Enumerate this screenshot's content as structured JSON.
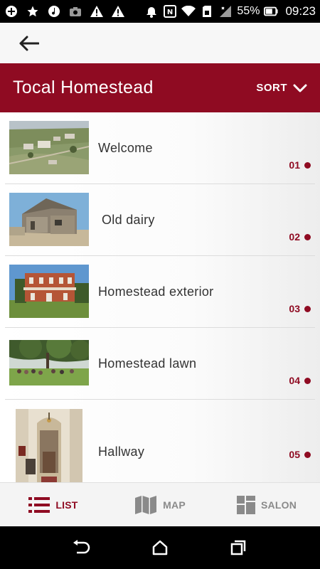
{
  "status_bar": {
    "battery": "55%",
    "time": "09:23",
    "icons": [
      "plus-circle-icon",
      "star-icon",
      "music-note-icon",
      "camera-icon",
      "warning-icon",
      "warning-icon",
      "mute-icon",
      "nfc-icon",
      "wifi-icon",
      "sd-icon",
      "signal-icon",
      "battery-icon"
    ]
  },
  "top_bar": {
    "back_icon": "arrow-left-icon"
  },
  "header": {
    "title": "Tocal Homestead",
    "sort_label": "SORT",
    "accent": "#8f0b22"
  },
  "list": {
    "items": [
      {
        "title": "Welcome",
        "number": "01",
        "image": "aerial farm view"
      },
      {
        "title": "Old dairy",
        "number": "02",
        "image": "timber dairy building"
      },
      {
        "title": "Homestead exterior",
        "number": "03",
        "image": "red brick homestead"
      },
      {
        "title": "Homestead lawn",
        "number": "04",
        "image": "people on lawn under tree"
      },
      {
        "title": "Hallway",
        "number": "05",
        "image": "interior hallway"
      }
    ]
  },
  "bottom_nav": {
    "tabs": [
      {
        "label": "LIST",
        "icon": "list-icon",
        "active": true
      },
      {
        "label": "MAP",
        "icon": "map-icon",
        "active": false
      },
      {
        "label": "SALON",
        "icon": "grid-icon",
        "active": false
      }
    ]
  },
  "system_nav": {
    "icons": [
      "back-icon",
      "home-icon",
      "recents-icon"
    ]
  }
}
